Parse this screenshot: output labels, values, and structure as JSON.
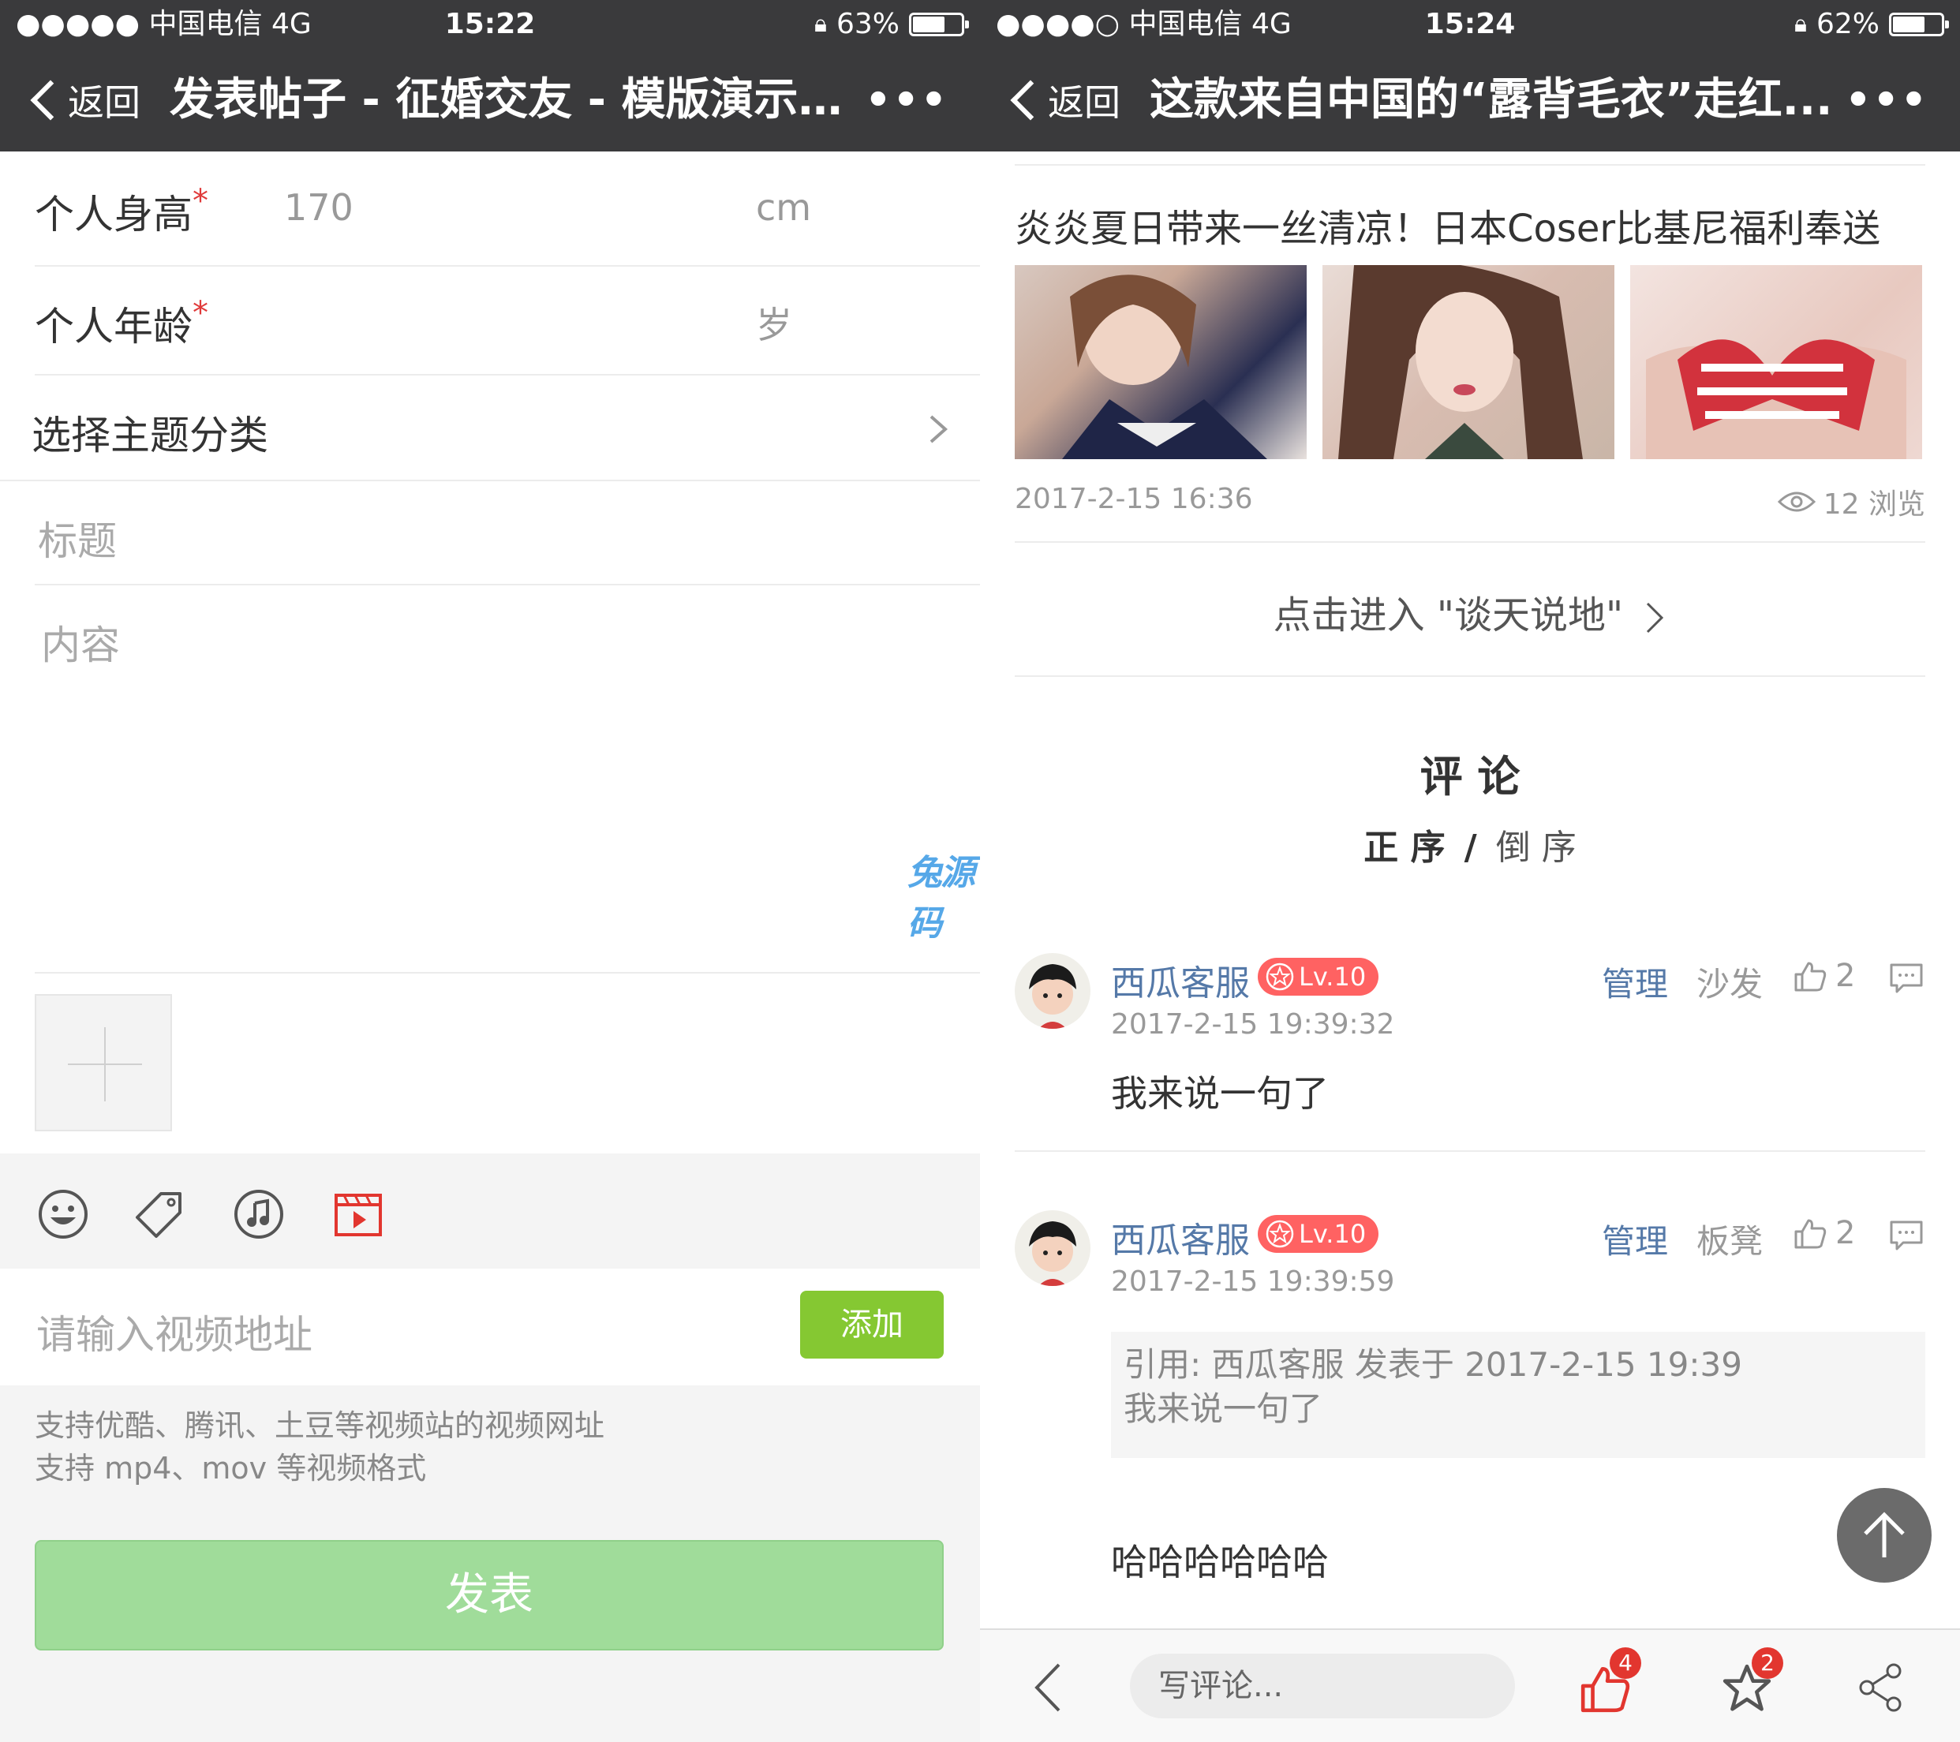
{
  "left": {
    "status": {
      "carrier": "●●●●● 中国电信   4G",
      "time": "15:22",
      "battery": "63%",
      "battery_level": 0.63
    },
    "nav": {
      "back_label": "返回",
      "title": "发表帖子 - 征婚交友 - 模版演示站...",
      "more": "•••"
    },
    "form": {
      "height_label": "个人身高",
      "height_value": "170",
      "height_unit": "cm",
      "age_label": "个人年龄",
      "age_unit": "岁",
      "required_mark": "*",
      "category_label": "选择主题分类",
      "title_placeholder": "标题",
      "content_placeholder": "内容"
    },
    "video": {
      "placeholder": "请输入视频地址",
      "add_label": "添加"
    },
    "hints": [
      "支持优酷、腾讯、土豆等视频站的视频网址",
      "支持 mp4、mov 等视频格式"
    ],
    "submit_label": "发表",
    "watermark": "兔源码"
  },
  "right": {
    "status": {
      "carrier": "●●●●○ 中国电信   4G",
      "time": "15:24",
      "battery": "62%",
      "battery_level": 0.62
    },
    "nav": {
      "back_label": "返回",
      "title": "这款来自中国的“露背毛衣”走红...",
      "more": "•••"
    },
    "related": {
      "title": "炎炎夏日带来一丝清凉！日本Coser比基尼福利奉送",
      "date": "2017-2-15 16:36",
      "views": "12 浏览"
    },
    "enter_link": "点击进入 \"谈天说地\"",
    "comments_heading": "评 论",
    "sort": {
      "asc": "正 序",
      "sep": "/",
      "desc": "倒 序"
    },
    "comments": [
      {
        "user": "西瓜客服",
        "level": "Lv.10",
        "manage": "管理",
        "floor": "沙发",
        "likes": "2",
        "time": "2017-2-15 19:39:32",
        "text": "我来说一句了"
      },
      {
        "user": "西瓜客服",
        "level": "Lv.10",
        "manage": "管理",
        "floor": "板凳",
        "likes": "2",
        "time": "2017-2-15 19:39:59",
        "quote_header": "引用: 西瓜客服 发表于 2017-2-15 19:39",
        "quote_text": "我来说一句了",
        "text": "哈哈哈哈哈哈"
      }
    ],
    "bottom": {
      "comment_placeholder": "写评论...",
      "like_count": "4",
      "fav_count": "2"
    }
  },
  "colors": {
    "nav_bg": "#3a3a3c",
    "accent_green": "#85c832",
    "submit_green": "#a0dc9a",
    "link_blue": "#5579a8",
    "badge_red": "#e2362f",
    "level_red": "#ff6262"
  }
}
